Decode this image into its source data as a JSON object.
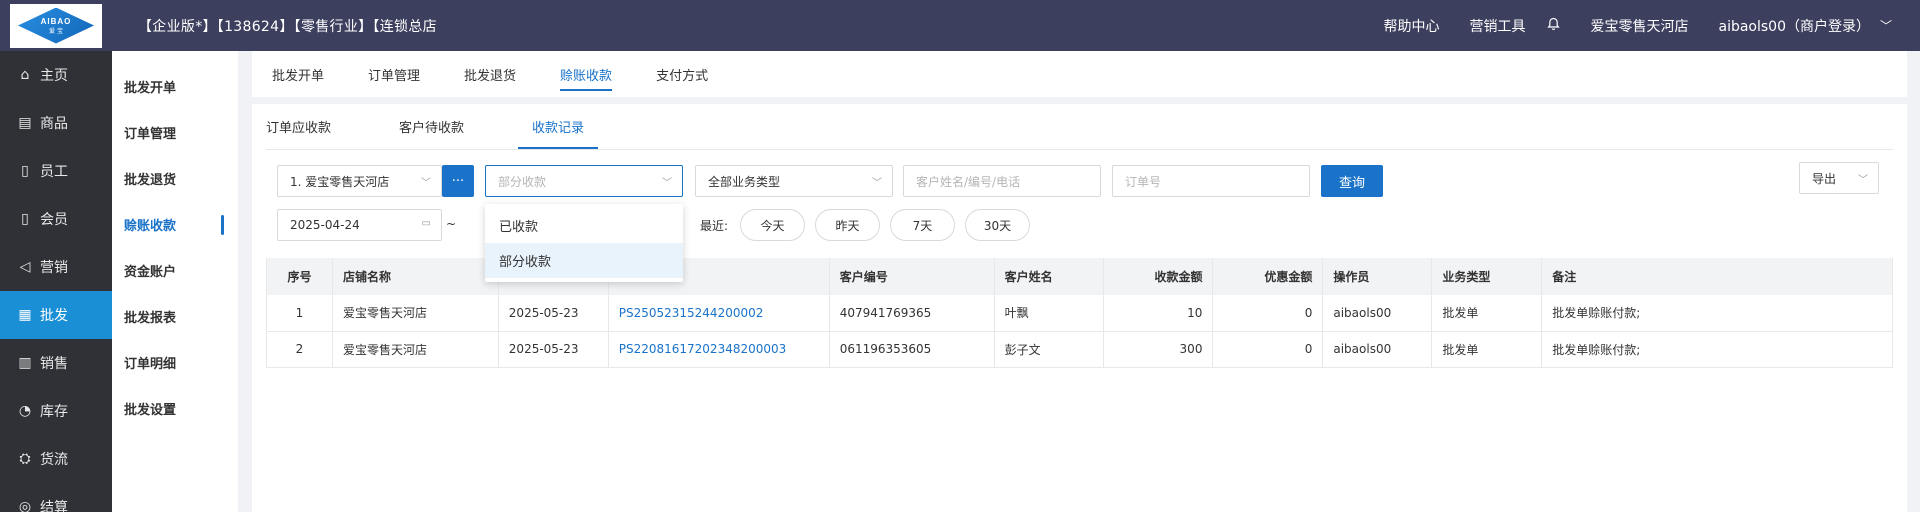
{
  "logo": {
    "line1": "AIBAO",
    "line2": "爱 宝"
  },
  "header": {
    "edition": "【企业版*】【138624】【零售行业】【连锁总店",
    "links": [
      "帮助中心",
      "营销工具"
    ],
    "store": "爱宝零售天河店",
    "user": "aibaols00（商户登录）"
  },
  "sidebar": {
    "items": [
      {
        "icon": "⌂",
        "label": "主页"
      },
      {
        "icon": "▤",
        "label": "商品"
      },
      {
        "icon": "▯",
        "label": "员工"
      },
      {
        "icon": "▯",
        "label": "会员"
      },
      {
        "icon": "◁",
        "label": "营销"
      },
      {
        "icon": "▦",
        "label": "批发"
      },
      {
        "icon": "▥",
        "label": "销售"
      },
      {
        "icon": "◔",
        "label": "库存"
      },
      {
        "icon": "⛭",
        "label": "货流"
      },
      {
        "icon": "◎",
        "label": "结算"
      }
    ],
    "active_index": 5
  },
  "subnav": {
    "items": [
      "批发开单",
      "订单管理",
      "批发退货",
      "赊账收款",
      "资金账户",
      "批发报表",
      "订单明细",
      "批发设置"
    ],
    "active_index": 3
  },
  "tabs1": {
    "items": [
      "批发开单",
      "订单管理",
      "批发退货",
      "赊账收款",
      "支付方式"
    ],
    "active_index": 3
  },
  "tabs2": {
    "items": [
      "订单应收款",
      "客户待收款",
      "收款记录"
    ],
    "active_index": 2
  },
  "filters": {
    "store_select": "1. 爱宝零售天河店",
    "more_label": "···",
    "status_placeholder": "部分收款",
    "type_select": "全部业务类型",
    "customer_placeholder": "客户姓名/编号/电话",
    "order_placeholder": "订单号",
    "query_label": "查询",
    "export_label": "导出",
    "date_start": "2025-04-24",
    "date_sep": "~",
    "recent_label": "最近:",
    "quick": [
      "今天",
      "昨天",
      "7天",
      "30天"
    ]
  },
  "dropdown": {
    "options": [
      "已收款",
      "部分收款"
    ],
    "selected_index": 1
  },
  "table": {
    "headers": [
      "序号",
      "店铺名称",
      "",
      "",
      "客户编号",
      "客户姓名",
      "收款金额",
      "优惠金额",
      "操作员",
      "业务类型",
      "备注"
    ],
    "rows": [
      [
        "1",
        "爱宝零售天河店",
        "2025-05-23",
        "PS25052315244200002",
        "407941769365",
        "叶飘",
        "10",
        "0",
        "aibaols00",
        "批发单",
        "批发单赊账付款;"
      ],
      [
        "2",
        "爱宝零售天河店",
        "2025-05-23",
        "PS22081617202348200003",
        "061196353605",
        "彭子文",
        "300",
        "0",
        "aibaols00",
        "批发单",
        "批发单赊账付款;"
      ]
    ]
  }
}
